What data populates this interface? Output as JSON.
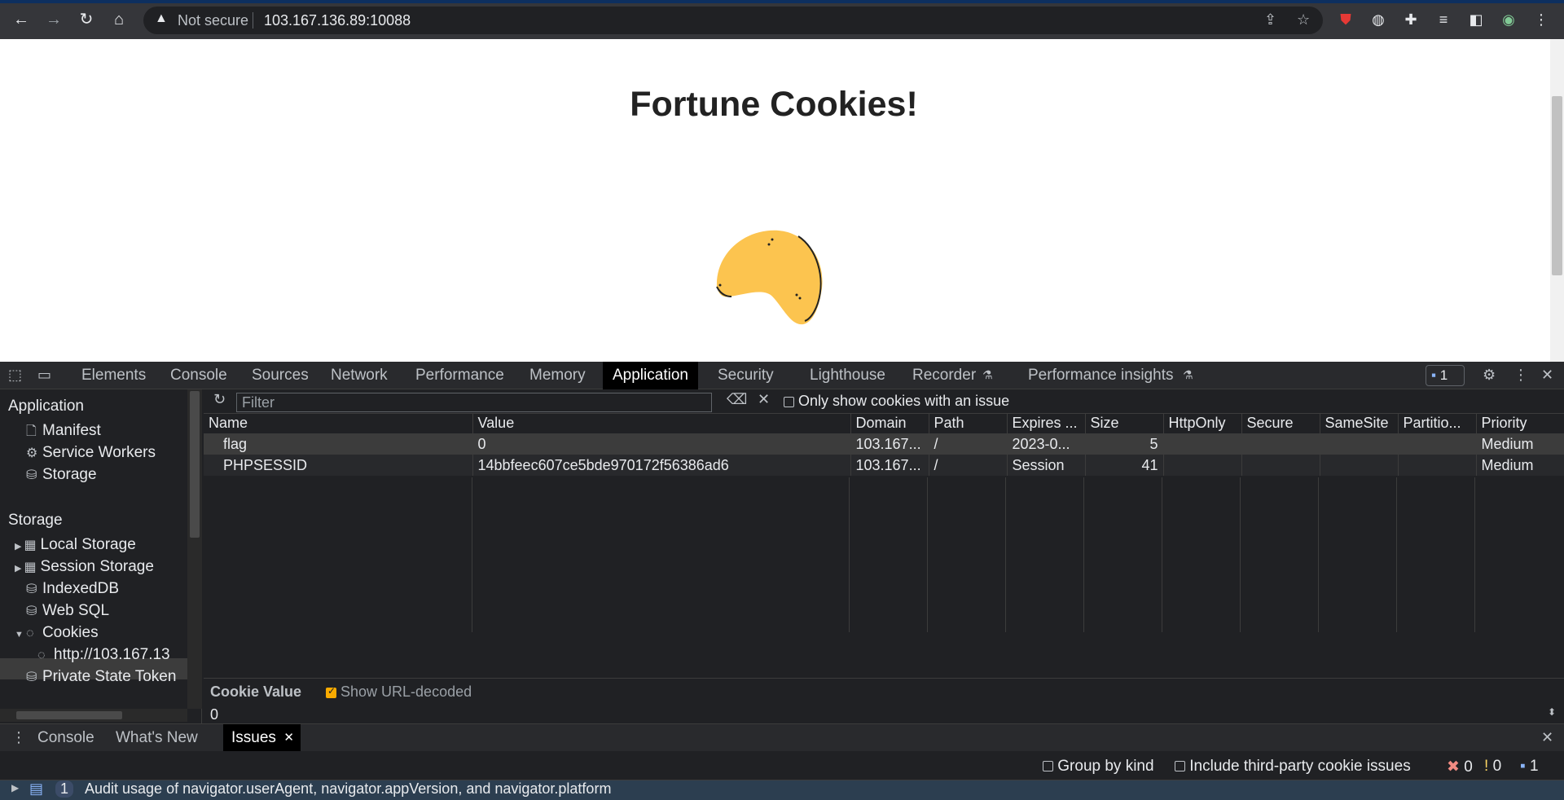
{
  "browser": {
    "not_secure": "Not secure",
    "url": "103.167.136.89:10088"
  },
  "page": {
    "title": "Fortune Cookies!"
  },
  "devtools": {
    "tabs": [
      "Elements",
      "Console",
      "Sources",
      "Network",
      "Performance",
      "Memory",
      "Application",
      "Security",
      "Lighthouse",
      "Recorder",
      "Performance insights"
    ],
    "active_tab": "Application",
    "issues_count": "1",
    "sidebar": {
      "application_heading": "Application",
      "application_items": [
        "Manifest",
        "Service Workers",
        "Storage"
      ],
      "storage_heading": "Storage",
      "storage_items": [
        "Local Storage",
        "Session Storage",
        "IndexedDB",
        "Web SQL",
        "Cookies"
      ],
      "cookie_origin": "http://103.167.13",
      "more_items": [
        "Private State Token"
      ]
    },
    "toolbar": {
      "filter_placeholder": "Filter",
      "only_issue": "Only show cookies with an issue"
    },
    "table": {
      "columns": [
        "Name",
        "Value",
        "Domain",
        "Path",
        "Expires ...",
        "Size",
        "HttpOnly",
        "Secure",
        "SameSite",
        "Partitio...",
        "Priority"
      ],
      "rows": [
        [
          "flag",
          "0",
          "103.167...",
          "/",
          "2023-0...",
          "5",
          "",
          "",
          "",
          "",
          "Medium"
        ],
        [
          "PHPSESSID",
          "14bbfeec607ce5bde970172f56386ad6",
          "103.167...",
          "/",
          "Session",
          "41",
          "",
          "",
          "",
          "",
          "Medium"
        ]
      ]
    },
    "cookie_value": {
      "label": "Cookie Value",
      "show_decoded": "Show URL-decoded",
      "value": "0"
    },
    "drawer": {
      "tabs": [
        "Console",
        "What's New",
        "Issues"
      ],
      "active_tab": "Issues",
      "group_by_kind": "Group by kind",
      "third_party": "Include third-party cookie issues",
      "counts": [
        "0",
        "0",
        "1"
      ],
      "issue_text": "Audit usage of navigator.userAgent, navigator.appVersion, and navigator.platform",
      "issue_count": "1"
    }
  }
}
